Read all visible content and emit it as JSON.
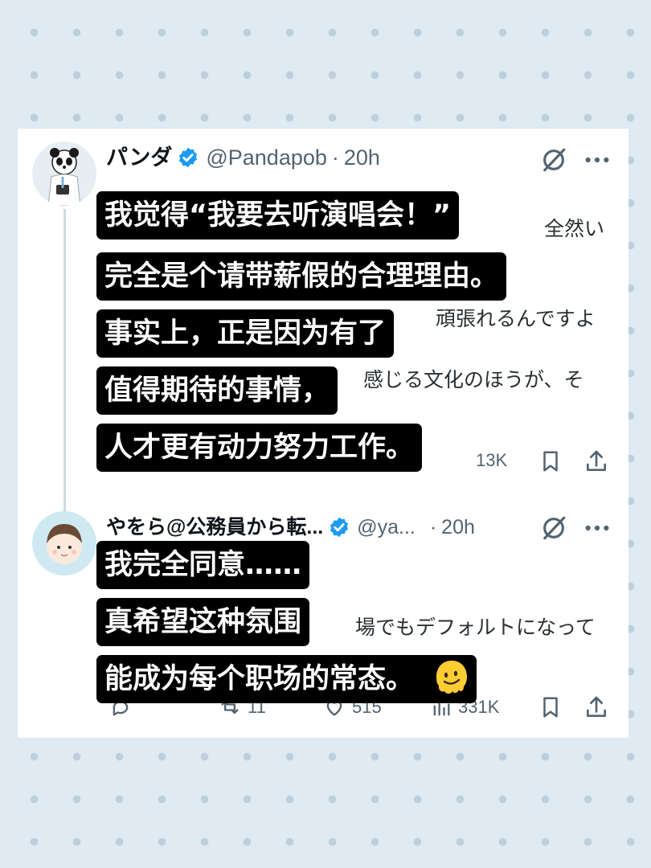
{
  "post1": {
    "name": "パンダ",
    "handle": "@Pandapob",
    "dot": "·",
    "time": "20h",
    "bg_fragments": [
      "全然い",
      "頑張れるんですよ",
      "感じる文化のほうが、そ"
    ],
    "actions": {
      "views": "13K"
    }
  },
  "post2": {
    "name": "やをら@公務員から転...",
    "handle": "@ya...",
    "dot": "·",
    "time": "20h",
    "bg_fragments": [
      "場でもデフォルトになって"
    ],
    "actions": {
      "retweets": "11",
      "likes": "515",
      "views": "331K"
    }
  },
  "captions": [
    "我觉得“我要去听演唱会！”",
    "完全是个请带薪假的合理理由。",
    "事实上，正是因为有了",
    "值得期待的事情，",
    "人才更有动力努力工作。",
    "我完全同意……",
    "真希望这种氛围",
    "能成为每个职场的常态。"
  ],
  "icons": {
    "verified": "verified-badge-icon",
    "grok": "grok-slash-icon",
    "more": "more-dots-icon",
    "bookmark": "bookmark-icon",
    "share": "share-icon",
    "reply": "reply-icon",
    "retweet": "retweet-icon",
    "like": "heart-icon",
    "views": "views-bars-icon",
    "emoji": "melting-face-emoji"
  },
  "colors": {
    "verified": "#1d9bf0",
    "caption_bg": "#000000",
    "caption_text": "#ffffff",
    "secondary_text": "#536471"
  }
}
